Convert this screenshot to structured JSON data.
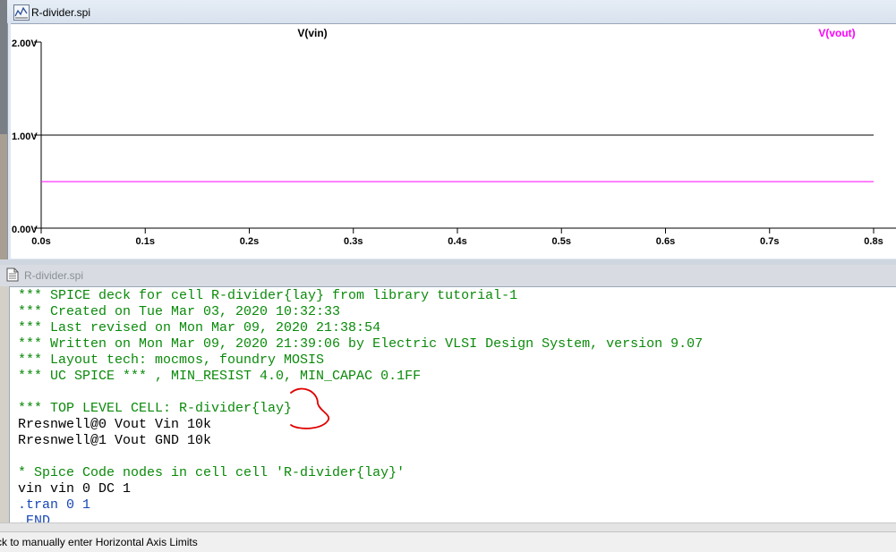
{
  "top_window": {
    "title": "R-divider.spi",
    "icon": "waveform-plot-icon"
  },
  "bottom_window": {
    "title": "R-divider.spi",
    "icon": "netlist-document-icon"
  },
  "chart_data": {
    "type": "line",
    "title": "",
    "xlabel": "",
    "ylabel": "",
    "x_tick_labels": [
      "0.0s",
      "0.1s",
      "0.2s",
      "0.3s",
      "0.4s",
      "0.5s",
      "0.6s",
      "0.7s",
      "0.8s"
    ],
    "y_tick_labels": [
      "0.00V",
      "1.00V",
      "2.00V"
    ],
    "xlim": [
      0,
      0.8
    ],
    "ylim": [
      0,
      2
    ],
    "series": [
      {
        "name": "V(vin)",
        "color": "#000000",
        "x": [
          0,
          0.8
        ],
        "y": [
          1,
          1
        ]
      },
      {
        "name": "V(vout)",
        "color": "#ff00ff",
        "x": [
          0,
          0.8
        ],
        "y": [
          0.5,
          0.5
        ]
      }
    ]
  },
  "netlist": {
    "lines": [
      {
        "text": "*** SPICE deck for cell R-divider{lay} from library tutorial-1",
        "color": "green"
      },
      {
        "text": "*** Created on Tue Mar 03, 2020 10:32:33",
        "color": "green"
      },
      {
        "text": "*** Last revised on Mon Mar 09, 2020 21:38:54",
        "color": "green"
      },
      {
        "text": "*** Written on Mon Mar 09, 2020 21:39:06 by Electric VLSI Design System, version 9.07",
        "color": "green"
      },
      {
        "text": "*** Layout tech: mocmos, foundry MOSIS",
        "color": "green"
      },
      {
        "text": "*** UC SPICE *** , MIN_RESIST 4.0, MIN_CAPAC 0.1FF",
        "color": "green"
      },
      {
        "text": "",
        "color": "black"
      },
      {
        "text": "*** TOP LEVEL CELL: R-divider{lay}",
        "color": "green"
      },
      {
        "text": "Rresnwell@0 Vout Vin 10k",
        "color": "black"
      },
      {
        "text": "Rresnwell@1 Vout GND 10k",
        "color": "black"
      },
      {
        "text": "",
        "color": "black"
      },
      {
        "text": "* Spice Code nodes in cell cell 'R-divider{lay}'",
        "color": "green"
      },
      {
        "text": "vin vin 0 DC 1",
        "color": "black"
      },
      {
        "text": ".tran 0 1",
        "color": "blue"
      },
      {
        "text": ".END",
        "color": "blue"
      }
    ],
    "annotation_color": "#e00000"
  },
  "status_bar": {
    "text": "ck to manually enter Horizontal Axis Limits"
  }
}
